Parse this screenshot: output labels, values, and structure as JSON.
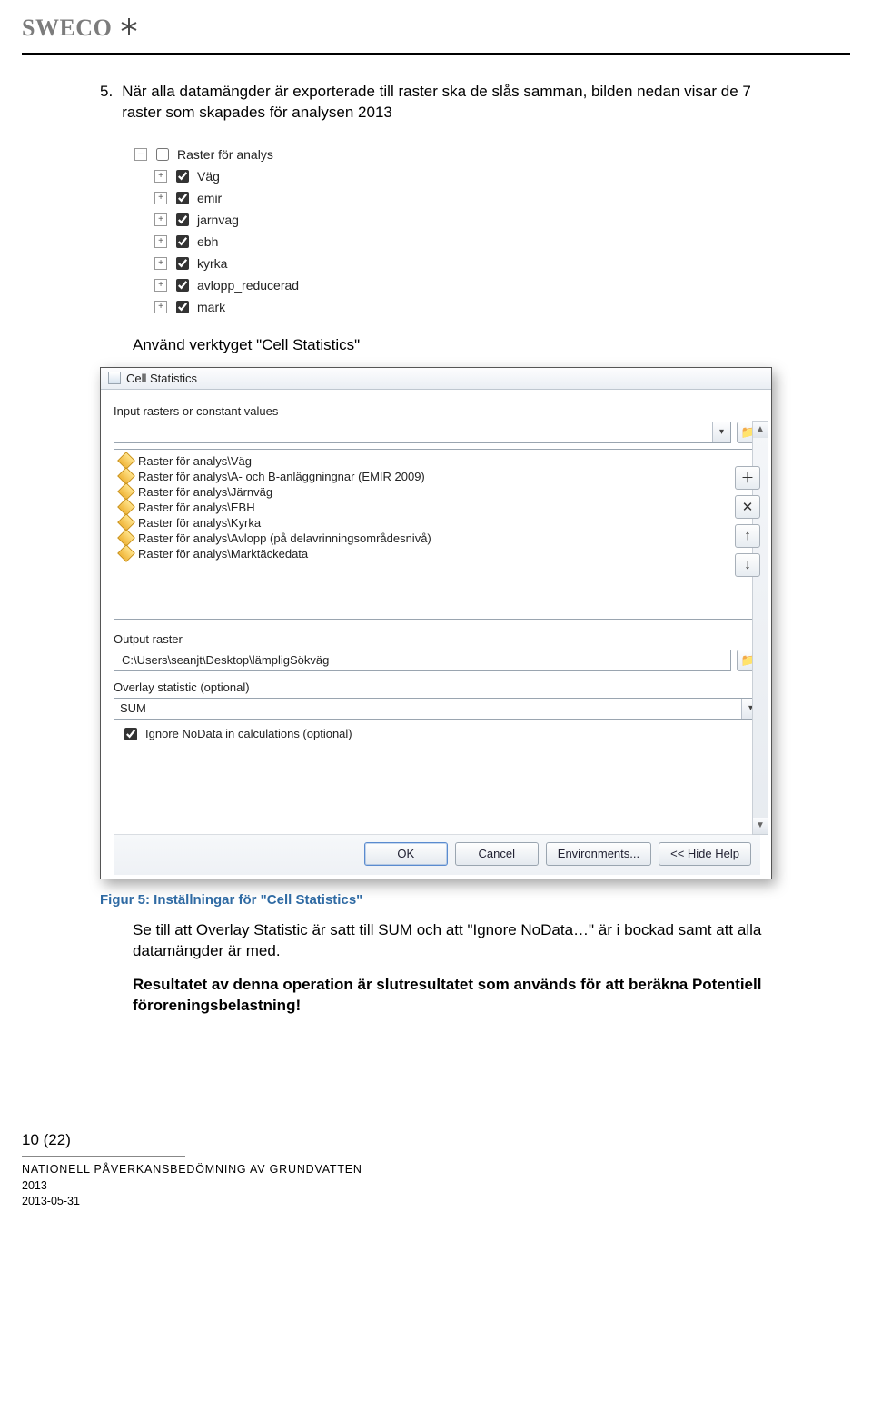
{
  "header": {
    "brand": "SWECO"
  },
  "body": {
    "step_number": "5.",
    "step_text": "När alla datamängder är exporterade till raster ska de slås samman, bilden nedan visar de 7 raster som skapades för analysen 2013",
    "layers_group": "Raster för analys",
    "layers": [
      "Väg",
      "emir",
      "jarnvag",
      "ebh",
      "kyrka",
      "avlopp_reducerad",
      "mark"
    ],
    "use_tool": "Använd verktyget \"Cell Statistics\"",
    "dialog": {
      "title": "Cell Statistics",
      "input_label": "Input rasters or constant values",
      "items": [
        "Raster för analys\\Väg",
        "Raster för analys\\A- och B-anläggningnar (EMIR 2009)",
        "Raster för analys\\Järnväg",
        "Raster för analys\\EBH",
        "Raster för analys\\Kyrka",
        "Raster för analys\\Avlopp (på delavrinningsområdesnivå)",
        "Raster för analys\\Marktäckedata"
      ],
      "output_label": "Output raster",
      "output_value": "C:\\Users\\seanjt\\Desktop\\lämpligSökväg",
      "overlay_label": "Overlay statistic (optional)",
      "overlay_value": "SUM",
      "ignore_label": "Ignore NoData in calculations (optional)",
      "buttons": {
        "ok": "OK",
        "cancel": "Cancel",
        "env": "Environments...",
        "help": "<< Hide Help"
      }
    },
    "figure_caption": "Figur 5: Inställningar för \"Cell Statistics\"",
    "para1": "Se till att Overlay Statistic är satt till SUM och att \"Ignore NoData…\" är i bockad samt att alla datamängder är med.",
    "para2": "Resultatet av denna operation är slutresultatet som används för att beräkna Potentiell föroreningsbelastning!"
  },
  "footer": {
    "page": "10 (22)",
    "line1": "NATIONELL PÅVERKANSBEDÖMNING AV GRUNDVATTEN",
    "year": "2013",
    "date": "2013-05-31"
  }
}
